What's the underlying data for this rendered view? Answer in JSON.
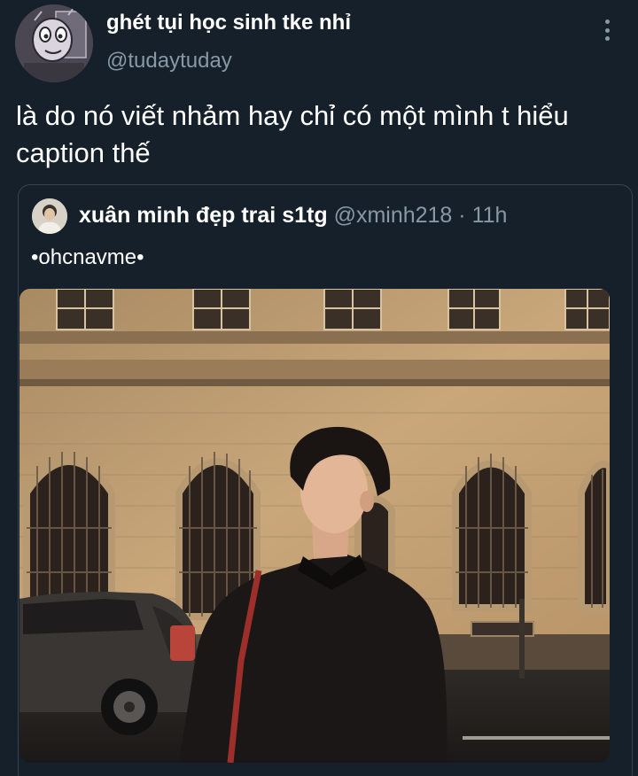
{
  "tweet": {
    "display_name": "ghét tụi học sinh tke nhỉ",
    "handle": "@tudaytuday",
    "text": "là do nó viết nhảm hay chỉ có một mình t hiểu caption thế",
    "avatar_icon": "cartoon-face-avatar",
    "more_icon": "vertical-dots-icon"
  },
  "quoted_tweet": {
    "display_name": "xuân minh đẹp trai s1tg",
    "handle": "@xminh218",
    "separator": "·",
    "time": "11h",
    "text": "•ohcnavme•",
    "media_icon": "photo-man-night-street"
  },
  "colors": {
    "background": "#15202b",
    "secondary_text": "#8899a6",
    "border": "#38444d"
  }
}
